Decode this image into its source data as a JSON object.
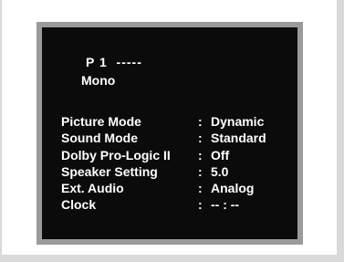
{
  "osd": {
    "channel": "P 1  -----",
    "audio": "Mono",
    "separator": ":",
    "rows": [
      {
        "label": "Picture Mode",
        "value": "Dynamic"
      },
      {
        "label": "Sound Mode",
        "value": "Standard"
      },
      {
        "label": "Dolby Pro-Logic II",
        "value": "Off"
      },
      {
        "label": "Speaker Setting",
        "value": "5.0"
      },
      {
        "label": "Ext. Audio",
        "value": "Analog"
      },
      {
        "label": "Clock",
        "value": "-- : --"
      }
    ]
  }
}
